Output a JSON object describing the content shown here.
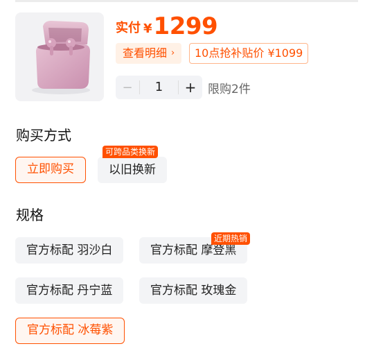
{
  "price": {
    "label": "实付",
    "currency": "¥",
    "value": "1299"
  },
  "detail_button": {
    "label": "查看明细",
    "chevron": "›"
  },
  "subsidy_tag": "10点抢补贴价 ¥1099",
  "quantity": {
    "minus": "−",
    "value": "1",
    "plus": "+",
    "limit": "限购2件"
  },
  "purchase_method": {
    "title": "购买方式",
    "options": [
      {
        "label": "立即购买",
        "selected": true
      },
      {
        "label": "以旧换新",
        "selected": false,
        "badge": "可跨品类换新"
      }
    ]
  },
  "spec": {
    "title": "规格",
    "options": [
      {
        "label": "官方标配 羽沙白",
        "selected": false
      },
      {
        "label": "官方标配 摩登黑",
        "selected": false,
        "badge": "近期热销"
      },
      {
        "label": "官方标配 丹宁蓝",
        "selected": false
      },
      {
        "label": "官方标配 玫瑰金",
        "selected": false
      },
      {
        "label": "官方标配 冰莓紫",
        "selected": true
      }
    ]
  },
  "colors": {
    "accent": "#ff5000",
    "option_bg": "#f3f4f6",
    "product_pink": "#d9a9c0"
  }
}
